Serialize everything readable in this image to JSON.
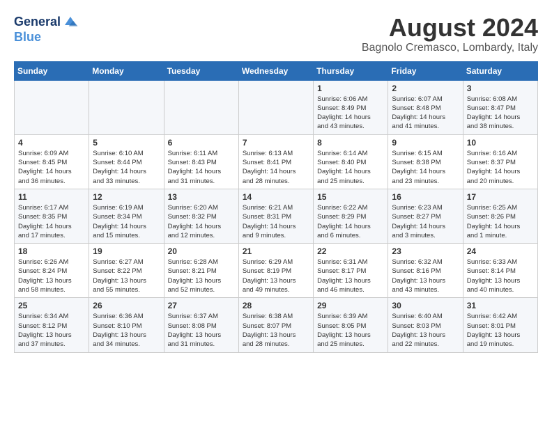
{
  "header": {
    "logo_line1": "General",
    "logo_line2": "Blue",
    "month_title": "August 2024",
    "location": "Bagnolo Cremasco, Lombardy, Italy"
  },
  "weekdays": [
    "Sunday",
    "Monday",
    "Tuesday",
    "Wednesday",
    "Thursday",
    "Friday",
    "Saturday"
  ],
  "weeks": [
    [
      {
        "day": "",
        "info": ""
      },
      {
        "day": "",
        "info": ""
      },
      {
        "day": "",
        "info": ""
      },
      {
        "day": "",
        "info": ""
      },
      {
        "day": "1",
        "info": "Sunrise: 6:06 AM\nSunset: 8:49 PM\nDaylight: 14 hours\nand 43 minutes."
      },
      {
        "day": "2",
        "info": "Sunrise: 6:07 AM\nSunset: 8:48 PM\nDaylight: 14 hours\nand 41 minutes."
      },
      {
        "day": "3",
        "info": "Sunrise: 6:08 AM\nSunset: 8:47 PM\nDaylight: 14 hours\nand 38 minutes."
      }
    ],
    [
      {
        "day": "4",
        "info": "Sunrise: 6:09 AM\nSunset: 8:45 PM\nDaylight: 14 hours\nand 36 minutes."
      },
      {
        "day": "5",
        "info": "Sunrise: 6:10 AM\nSunset: 8:44 PM\nDaylight: 14 hours\nand 33 minutes."
      },
      {
        "day": "6",
        "info": "Sunrise: 6:11 AM\nSunset: 8:43 PM\nDaylight: 14 hours\nand 31 minutes."
      },
      {
        "day": "7",
        "info": "Sunrise: 6:13 AM\nSunset: 8:41 PM\nDaylight: 14 hours\nand 28 minutes."
      },
      {
        "day": "8",
        "info": "Sunrise: 6:14 AM\nSunset: 8:40 PM\nDaylight: 14 hours\nand 25 minutes."
      },
      {
        "day": "9",
        "info": "Sunrise: 6:15 AM\nSunset: 8:38 PM\nDaylight: 14 hours\nand 23 minutes."
      },
      {
        "day": "10",
        "info": "Sunrise: 6:16 AM\nSunset: 8:37 PM\nDaylight: 14 hours\nand 20 minutes."
      }
    ],
    [
      {
        "day": "11",
        "info": "Sunrise: 6:17 AM\nSunset: 8:35 PM\nDaylight: 14 hours\nand 17 minutes."
      },
      {
        "day": "12",
        "info": "Sunrise: 6:19 AM\nSunset: 8:34 PM\nDaylight: 14 hours\nand 15 minutes."
      },
      {
        "day": "13",
        "info": "Sunrise: 6:20 AM\nSunset: 8:32 PM\nDaylight: 14 hours\nand 12 minutes."
      },
      {
        "day": "14",
        "info": "Sunrise: 6:21 AM\nSunset: 8:31 PM\nDaylight: 14 hours\nand 9 minutes."
      },
      {
        "day": "15",
        "info": "Sunrise: 6:22 AM\nSunset: 8:29 PM\nDaylight: 14 hours\nand 6 minutes."
      },
      {
        "day": "16",
        "info": "Sunrise: 6:23 AM\nSunset: 8:27 PM\nDaylight: 14 hours\nand 3 minutes."
      },
      {
        "day": "17",
        "info": "Sunrise: 6:25 AM\nSunset: 8:26 PM\nDaylight: 14 hours\nand 1 minute."
      }
    ],
    [
      {
        "day": "18",
        "info": "Sunrise: 6:26 AM\nSunset: 8:24 PM\nDaylight: 13 hours\nand 58 minutes."
      },
      {
        "day": "19",
        "info": "Sunrise: 6:27 AM\nSunset: 8:22 PM\nDaylight: 13 hours\nand 55 minutes."
      },
      {
        "day": "20",
        "info": "Sunrise: 6:28 AM\nSunset: 8:21 PM\nDaylight: 13 hours\nand 52 minutes."
      },
      {
        "day": "21",
        "info": "Sunrise: 6:29 AM\nSunset: 8:19 PM\nDaylight: 13 hours\nand 49 minutes."
      },
      {
        "day": "22",
        "info": "Sunrise: 6:31 AM\nSunset: 8:17 PM\nDaylight: 13 hours\nand 46 minutes."
      },
      {
        "day": "23",
        "info": "Sunrise: 6:32 AM\nSunset: 8:16 PM\nDaylight: 13 hours\nand 43 minutes."
      },
      {
        "day": "24",
        "info": "Sunrise: 6:33 AM\nSunset: 8:14 PM\nDaylight: 13 hours\nand 40 minutes."
      }
    ],
    [
      {
        "day": "25",
        "info": "Sunrise: 6:34 AM\nSunset: 8:12 PM\nDaylight: 13 hours\nand 37 minutes."
      },
      {
        "day": "26",
        "info": "Sunrise: 6:36 AM\nSunset: 8:10 PM\nDaylight: 13 hours\nand 34 minutes."
      },
      {
        "day": "27",
        "info": "Sunrise: 6:37 AM\nSunset: 8:08 PM\nDaylight: 13 hours\nand 31 minutes."
      },
      {
        "day": "28",
        "info": "Sunrise: 6:38 AM\nSunset: 8:07 PM\nDaylight: 13 hours\nand 28 minutes."
      },
      {
        "day": "29",
        "info": "Sunrise: 6:39 AM\nSunset: 8:05 PM\nDaylight: 13 hours\nand 25 minutes."
      },
      {
        "day": "30",
        "info": "Sunrise: 6:40 AM\nSunset: 8:03 PM\nDaylight: 13 hours\nand 22 minutes."
      },
      {
        "day": "31",
        "info": "Sunrise: 6:42 AM\nSunset: 8:01 PM\nDaylight: 13 hours\nand 19 minutes."
      }
    ]
  ]
}
